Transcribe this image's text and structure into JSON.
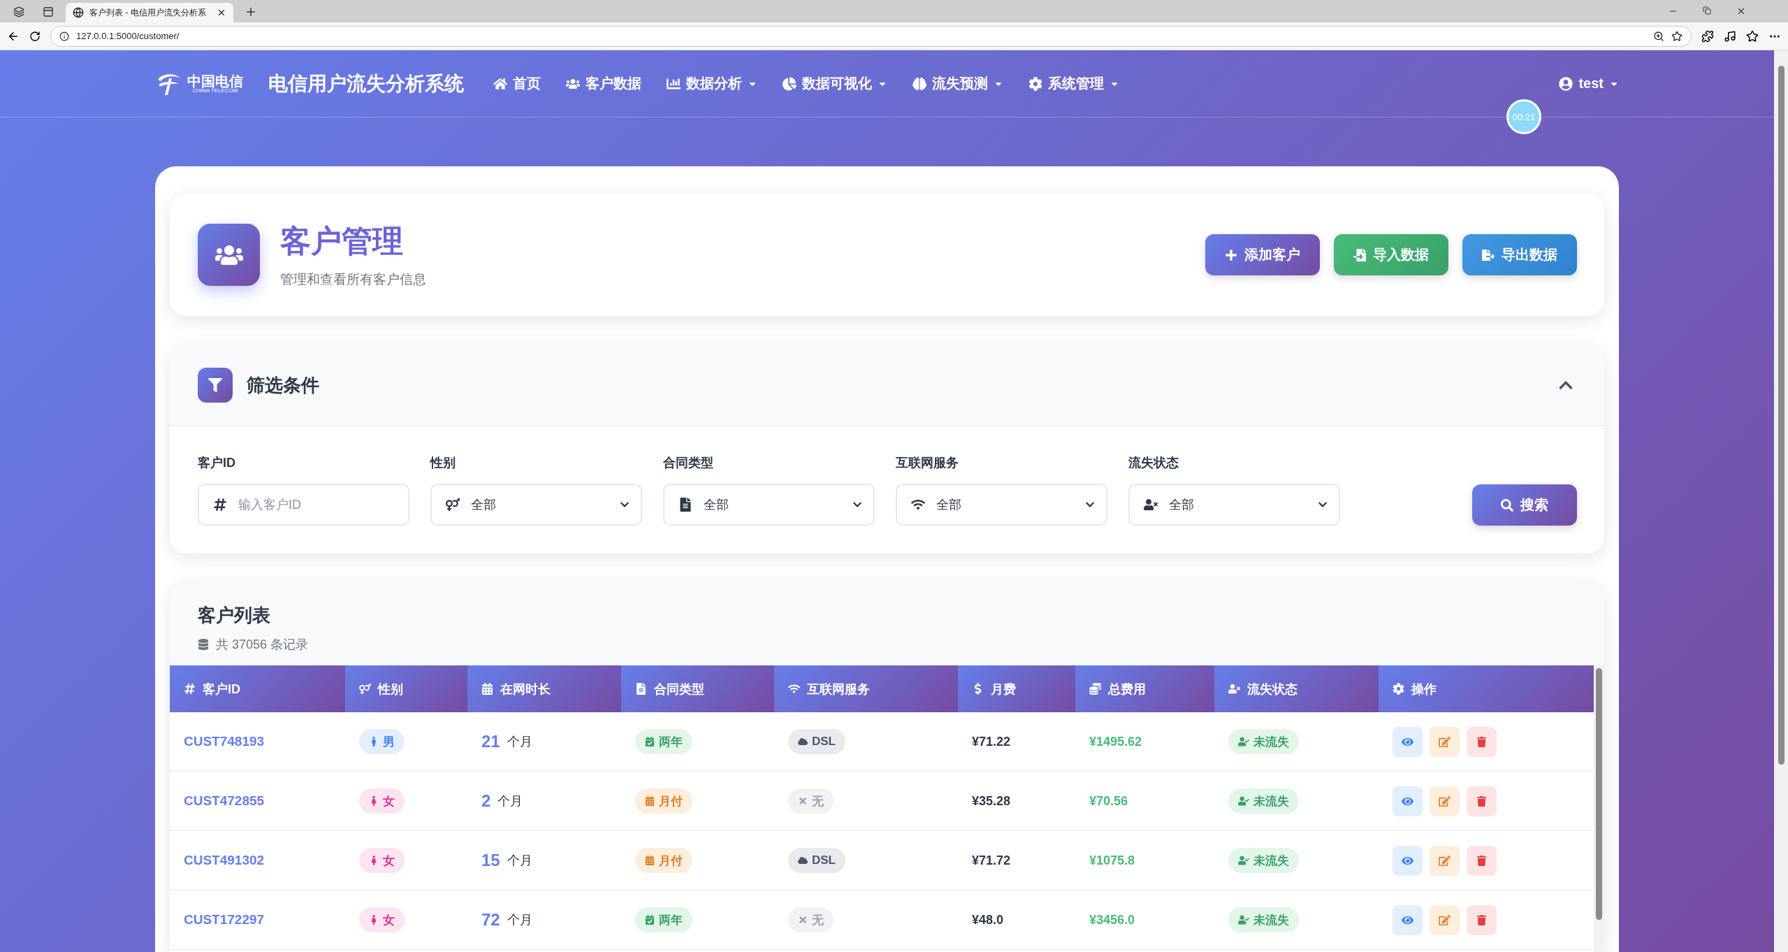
{
  "browser": {
    "tabs": [
      {
        "title": "客户列表 - 电信用户流失分析系",
        "selected": true
      }
    ],
    "url": "127.0.0.1:5000/customer/"
  },
  "navbar": {
    "logo_cn": "中国电信",
    "logo_en": "CHINA TELECOM",
    "title": "电信用户流失分析系统",
    "items": [
      {
        "label": "首页",
        "dropdown": false
      },
      {
        "label": "客户数据",
        "dropdown": false
      },
      {
        "label": "数据分析",
        "dropdown": true
      },
      {
        "label": "数据可视化",
        "dropdown": true
      },
      {
        "label": "流失预测",
        "dropdown": true
      },
      {
        "label": "系统管理",
        "dropdown": true
      }
    ],
    "user": {
      "name": "test",
      "dropdown": true
    }
  },
  "timer": "00:21",
  "page_header": {
    "title": "客户管理",
    "subtitle": "管理和查看所有客户信息",
    "buttons": [
      {
        "label": "添加客户",
        "kind": "add"
      },
      {
        "label": "导入数据",
        "kind": "import"
      },
      {
        "label": "导出数据",
        "kind": "export"
      }
    ]
  },
  "filter": {
    "title": "筛选条件",
    "expanded": true,
    "fields": [
      {
        "label": "客户ID",
        "kind": "input",
        "placeholder": "输入客户ID"
      },
      {
        "label": "性别",
        "kind": "select",
        "value": "全部"
      },
      {
        "label": "合同类型",
        "kind": "select",
        "value": "全部"
      },
      {
        "label": "互联网服务",
        "kind": "select",
        "value": "全部"
      },
      {
        "label": "流失状态",
        "kind": "select",
        "value": "全部"
      }
    ],
    "search_button": "搜索"
  },
  "customer_list": {
    "title": "客户列表",
    "count": "共 37056 条记录",
    "columns": [
      "客户ID",
      "性别",
      "在网时长",
      "合同类型",
      "互联网服务",
      "月费",
      "总费用",
      "流失状态",
      "操作"
    ],
    "rows": [
      {
        "id": "CUST748193",
        "gender": {
          "text": "男",
          "kind": "male"
        },
        "tenure": "21",
        "tenure_unit": "个月",
        "contract": {
          "text": "两年",
          "kind": "two_year"
        },
        "internet": {
          "text": "DSL",
          "kind": "dsl"
        },
        "monthly": "¥71.22",
        "total": "¥1495.62",
        "churn": {
          "text": "未流失",
          "kind": "retained"
        }
      },
      {
        "id": "CUST472855",
        "gender": {
          "text": "女",
          "kind": "female"
        },
        "tenure": "2",
        "tenure_unit": "个月",
        "contract": {
          "text": "月付",
          "kind": "monthly"
        },
        "internet": {
          "text": "无",
          "kind": "none"
        },
        "monthly": "¥35.28",
        "total": "¥70.56",
        "churn": {
          "text": "未流失",
          "kind": "retained"
        }
      },
      {
        "id": "CUST491302",
        "gender": {
          "text": "女",
          "kind": "female"
        },
        "tenure": "15",
        "tenure_unit": "个月",
        "contract": {
          "text": "月付",
          "kind": "monthly"
        },
        "internet": {
          "text": "DSL",
          "kind": "dsl"
        },
        "monthly": "¥71.72",
        "total": "¥1075.8",
        "churn": {
          "text": "未流失",
          "kind": "retained"
        }
      },
      {
        "id": "CUST172297",
        "gender": {
          "text": "女",
          "kind": "female"
        },
        "tenure": "72",
        "tenure_unit": "个月",
        "contract": {
          "text": "两年",
          "kind": "two_year"
        },
        "internet": {
          "text": "无",
          "kind": "none"
        },
        "monthly": "¥48.0",
        "total": "¥3456.0",
        "churn": {
          "text": "未流失",
          "kind": "retained"
        }
      }
    ]
  }
}
